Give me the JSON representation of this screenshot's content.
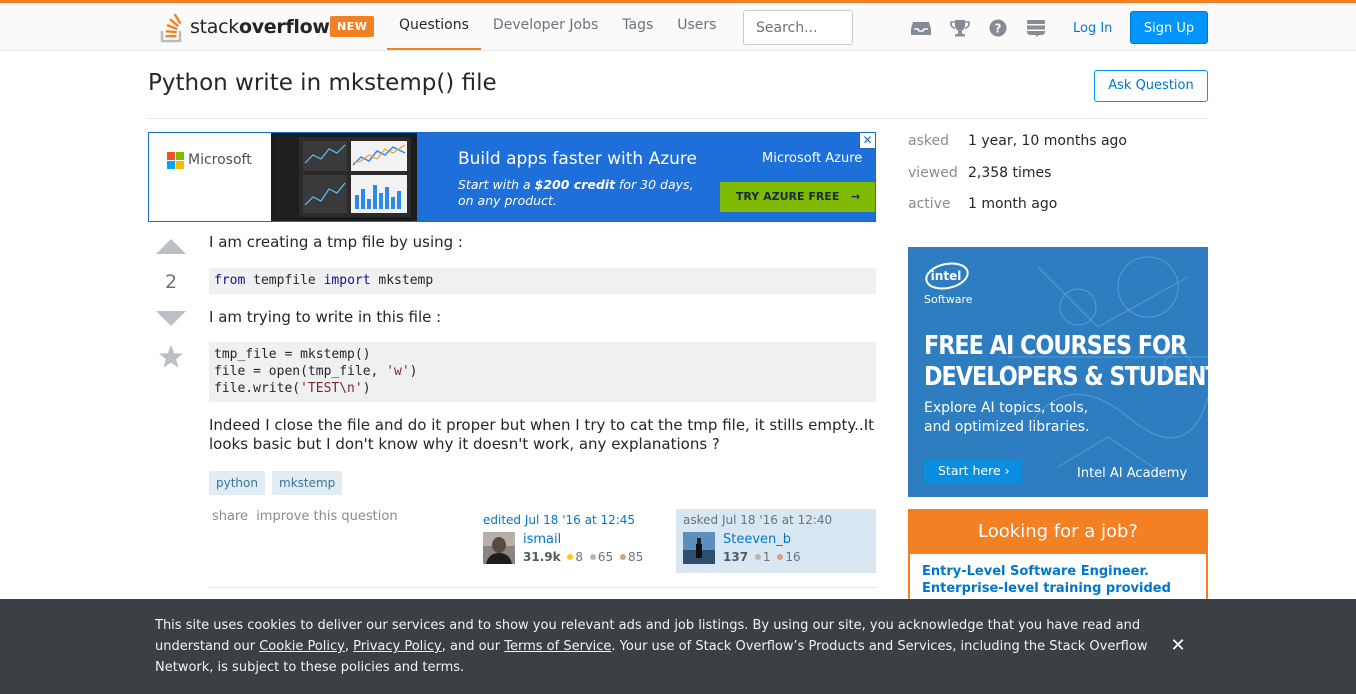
{
  "header": {
    "logo_text_light": "stack",
    "logo_text_bold": "overflow",
    "new_badge": "NEW",
    "nav": [
      "Questions",
      "Developer Jobs",
      "Tags",
      "Users"
    ],
    "search_placeholder": "Search...",
    "login": "Log In",
    "signup": "Sign Up",
    "accent_color": "#f48024",
    "icons": [
      "inbox-icon",
      "achievements-icon",
      "help-icon",
      "stackexchange-icon"
    ]
  },
  "question": {
    "title": "Python write in mkstemp() file",
    "ask_button": "Ask Question",
    "votes": "2",
    "body_1": "I am creating a tmp file by using :",
    "code_1": {
      "kw1": "from",
      "mid": " tempfile ",
      "kw2": "import",
      "end": " mkstemp"
    },
    "body_2": "I am trying to write in this file :",
    "code_2": {
      "line1": "tmp_file = mkstemp()",
      "line2_a": "file = open(tmp_file, ",
      "line2_str": "'w'",
      "line2_b": ")",
      "line3_a": "file.write(",
      "line3_str": "'TEST\\n'",
      "line3_b": ")"
    },
    "body_3": "Indeed I close the file and do it proper but when I try to cat the tmp file, it stills empty..It looks basic but I don't know why it doesn't work, any explanations ?",
    "tags": [
      "python",
      "mkstemp"
    ],
    "menu": {
      "share": "share",
      "improve": "improve this question"
    },
    "editor": {
      "when": "edited Jul 18 '16 at 12:45",
      "name": "ismail",
      "rep": "31.9k",
      "gold": "8",
      "silver": "65",
      "bronze": "85"
    },
    "owner": {
      "when": "asked Jul 18 '16 at 12:40",
      "name": "Steeven_b",
      "rep": "137",
      "silver": "1",
      "bronze": "16"
    }
  },
  "ad_left": {
    "brand_left": "Microsoft",
    "headline": "Build apps faster with Azure",
    "sub_a": "Start with a ",
    "sub_b": "$200 credit",
    "sub_c": " for 30 days,",
    "sub_d": "on any product.",
    "brand_right": "Microsoft Azure",
    "cta": "TRY AZURE FREE"
  },
  "sidebar": {
    "stats": [
      {
        "label": "asked",
        "value": "1 year, 10 months ago"
      },
      {
        "label": "viewed",
        "value": "2,358 times"
      },
      {
        "label": "active",
        "value": "1 month ago"
      }
    ],
    "ad_right": {
      "logo": "intel",
      "software": "Software",
      "head_1": "FREE AI COURSES FOR",
      "head_2": "DEVELOPERS & STUDENTS",
      "sub_1": "Explore AI topics, tools,",
      "sub_2": "and optimized libraries.",
      "button": "Start here ›",
      "academy": "Intel AI Academy"
    },
    "jobs": {
      "title": "Looking for a job?",
      "item_1": "Entry-Level Software Engineer.",
      "item_2": "Enterprise-level training provided"
    }
  },
  "cookie": {
    "part1": "This site uses cookies to deliver our services and to show you relevant ads and job listings. By using our site, you acknowledge that you have read and understand our ",
    "link1": "Cookie Policy",
    "sep1": ", ",
    "link2": "Privacy Policy",
    "sep2": ", and our ",
    "link3": "Terms of Service",
    "part2": ". Your use of Stack Overflow’s Products and Services, including the Stack Overflow Network, is subject to these policies and terms.",
    "close": "✕"
  }
}
